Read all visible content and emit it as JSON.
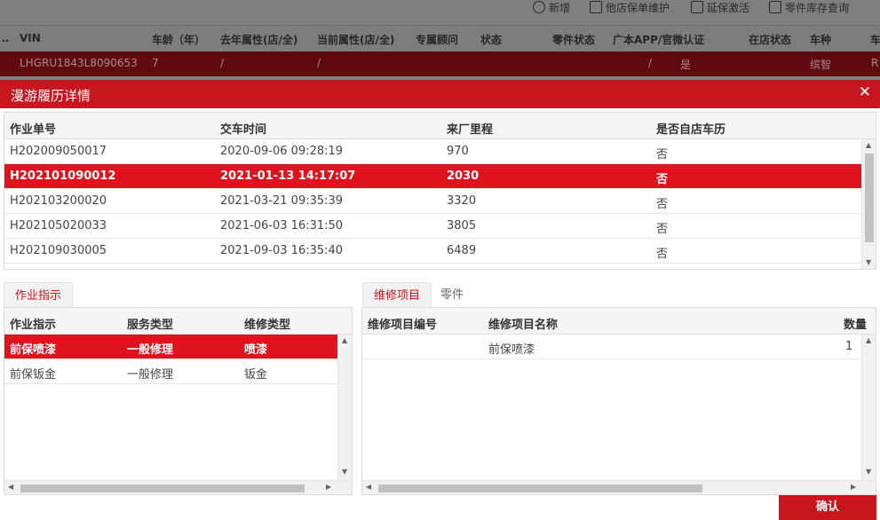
{
  "background": {
    "toolbar": [
      "新增",
      "他店保单维护",
      "延保激活",
      "零件库存查询"
    ],
    "header_cols": [
      "VIN",
      "车龄（年）",
      "去年属性(店/全)",
      "当前属性(店/全)",
      "专属顾问",
      "状态",
      "零件状态",
      "广本APP/官微认证",
      "在店状态",
      "车种",
      "车"
    ],
    "row": {
      "vin": "LHGRU1843L8090653",
      "age": "7",
      "last_attr": "/",
      "cur_attr": "/",
      "auth": "/",
      "auth_val": "是",
      "model": "缤智",
      "extra": "R"
    }
  },
  "dialog": {
    "title": "漫游履历详情",
    "close_icon": "close-icon",
    "history": {
      "columns": [
        "作业单号",
        "交车时间",
        "来厂里程",
        "是否自店车历"
      ],
      "rows": [
        {
          "order": "H202009050017",
          "time": "2020-09-06 09:28:19",
          "mileage": "970",
          "own": "否"
        },
        {
          "order": "H202101090012",
          "time": "2021-01-13 14:17:07",
          "mileage": "2030",
          "own": "否"
        },
        {
          "order": "H202103200020",
          "time": "2021-03-21 09:35:39",
          "mileage": "3320",
          "own": "否"
        },
        {
          "order": "H202105020033",
          "time": "2021-06-03 16:31:50",
          "mileage": "3805",
          "own": "否"
        },
        {
          "order": "H202109030005",
          "time": "2021-09-03 16:35:40",
          "mileage": "6489",
          "own": "否"
        }
      ]
    },
    "left_tab": "作业指示",
    "instructions": {
      "columns": [
        "作业指示",
        "服务类型",
        "维修类型"
      ],
      "rows": [
        {
          "instr": "前保喷漆",
          "service": "一般修理",
          "repair": "喷漆"
        },
        {
          "instr": "前保钣金",
          "service": "一般修理",
          "repair": "钣金"
        }
      ]
    },
    "right_tabs": [
      "维修项目",
      "零件"
    ],
    "items": {
      "columns": [
        "维修项目编号",
        "维修项目名称",
        "数量"
      ],
      "rows": [
        {
          "code": "",
          "name": "前保喷漆",
          "qty": "1"
        }
      ]
    },
    "confirm_label": "确认",
    "accent_color": "#c8161e",
    "selected_color": "#e0121e"
  }
}
